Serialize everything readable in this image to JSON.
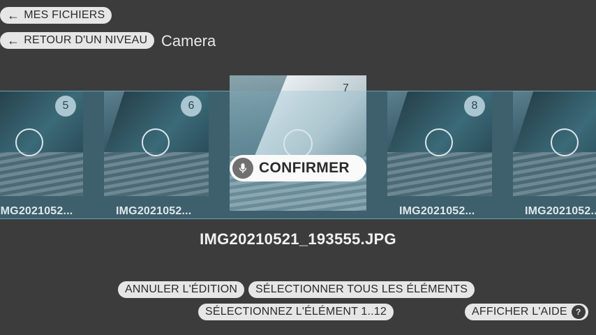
{
  "nav": {
    "my_files": "MES FICHIERS",
    "up_level": "RETOUR D'UN NIVEAU",
    "folder_title": "Camera"
  },
  "gallery": {
    "items": [
      {
        "number": "5",
        "label": "IMG2021052..."
      },
      {
        "number": "6",
        "label": "IMG2021052..."
      },
      {
        "number": "7",
        "label": ""
      },
      {
        "number": "8",
        "label": "IMG2021052..."
      },
      {
        "number": "",
        "label": "IMG2021052..."
      }
    ],
    "confirm_label": "CONFIRMER",
    "confirm_icon": "microphone-icon"
  },
  "selected_file": "IMG20210521_193555.JPG",
  "actions": {
    "cancel_edit": "ANNULER L'ÉDITION",
    "select_all": "SÉLECTIONNER TOUS LES ÉLÉMENTS",
    "select_item": "SÉLECTIONNEZ L'ÉLÉMENT 1..12",
    "show_help": "AFFICHER L'AIDE",
    "help_glyph": "?"
  },
  "colors": {
    "background": "#3c3c3c",
    "strip": "#3e5f6c",
    "pill": "#e6e6e6"
  }
}
